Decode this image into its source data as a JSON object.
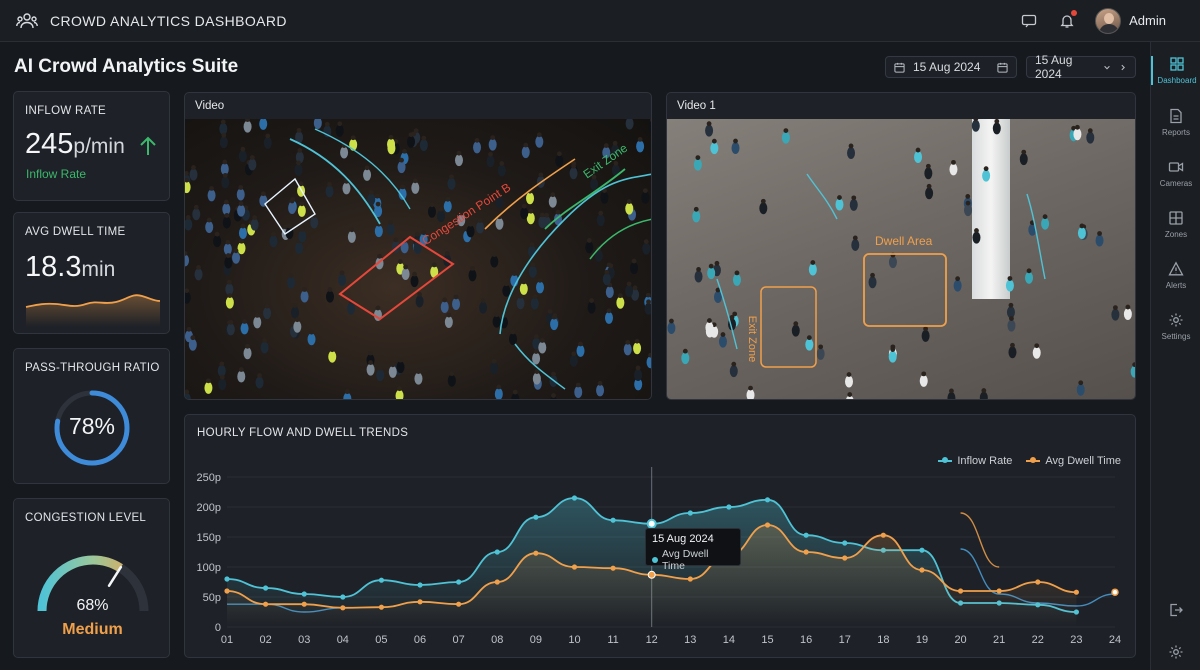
{
  "header": {
    "title": "CROWD ANALYTICS DASHBOARD",
    "user_name": "Admin"
  },
  "page": {
    "title": "AI Crowd Analytics Suite"
  },
  "date_filters": {
    "start": "15 Aug 2024",
    "end": "15 Aug 2024"
  },
  "sidebar": {
    "items": [
      {
        "label": "Dashboard",
        "icon": "dashboard-icon",
        "active": true
      },
      {
        "label": "Reports",
        "icon": "reports-icon"
      },
      {
        "label": "Cameras",
        "icon": "camera-icon"
      },
      {
        "label": "Zones",
        "icon": "zones-icon"
      },
      {
        "label": "Alerts",
        "icon": "alert-icon"
      },
      {
        "label": "Settings",
        "icon": "gear-icon"
      }
    ]
  },
  "kpis": {
    "inflow": {
      "label": "INFLOW RATE",
      "value": "245",
      "unit": "p/min",
      "sub": "Inflow Rate",
      "trend": "up"
    },
    "dwell": {
      "label": "AVG DWELL TIME",
      "value": "18.3",
      "unit": "min"
    },
    "pass": {
      "label": "PASS-THROUGH RATIO",
      "value": "78%",
      "ratio": 0.78
    },
    "congestion": {
      "label": "CONGESTION LEVEL",
      "value": "68%",
      "level": "Medium",
      "ratio": 0.68
    }
  },
  "videos": {
    "left": {
      "label": "Video",
      "zones": [
        "Congestion Point B",
        "Exit Zone"
      ]
    },
    "right": {
      "label": "Video 1",
      "zones": [
        "Dwell Area",
        "Exit Zone"
      ]
    }
  },
  "colors": {
    "accent": "#4fc3d6",
    "orange": "#f0a04b",
    "green": "#3bb86b",
    "red": "#e5483b",
    "blue_ring": "#3d8bd9"
  },
  "chart_data": {
    "type": "line",
    "title": "HOURLY FLOW AND DWELL TRENDS",
    "categories": [
      "01",
      "02",
      "03",
      "04",
      "05",
      "06",
      "07",
      "08",
      "09",
      "10",
      "11",
      "12",
      "13",
      "14",
      "15",
      "16",
      "17",
      "18",
      "19",
      "20",
      "21",
      "22",
      "23",
      "24"
    ],
    "y_ticks": [
      "0",
      "50p",
      "100p",
      "150p",
      "200p",
      "250p"
    ],
    "ylim": [
      0,
      250
    ],
    "series": [
      {
        "name": "Inflow Rate",
        "color": "#4fc3d6",
        "values": [
          80,
          65,
          55,
          50,
          78,
          70,
          75,
          125,
          183,
          215,
          178,
          172,
          190,
          200,
          212,
          153,
          140,
          128,
          128,
          40,
          40,
          37,
          25
        ]
      },
      {
        "name": "Avg Dwell Time",
        "color": "#f0a04b",
        "values": [
          60,
          38,
          38,
          32,
          33,
          42,
          38,
          75,
          123,
          100,
          98,
          87,
          80,
          120,
          170,
          125,
          115,
          153,
          95,
          60,
          60,
          75,
          58
        ]
      }
    ],
    "secondary_inflow": [
      38,
      38,
      25,
      32,
      null,
      null,
      null,
      null,
      null,
      null,
      null,
      null,
      null,
      null,
      null,
      null,
      null,
      null,
      null,
      130,
      55,
      40,
      35,
      55
    ],
    "secondary_dwell": [
      null,
      null,
      null,
      null,
      null,
      null,
      null,
      null,
      null,
      null,
      null,
      null,
      null,
      null,
      null,
      null,
      null,
      null,
      null,
      190,
      null,
      null,
      null,
      null
    ],
    "tooltip": {
      "title": "15 Aug 2024",
      "label": "Avg Dwell Time",
      "category": "12"
    }
  }
}
